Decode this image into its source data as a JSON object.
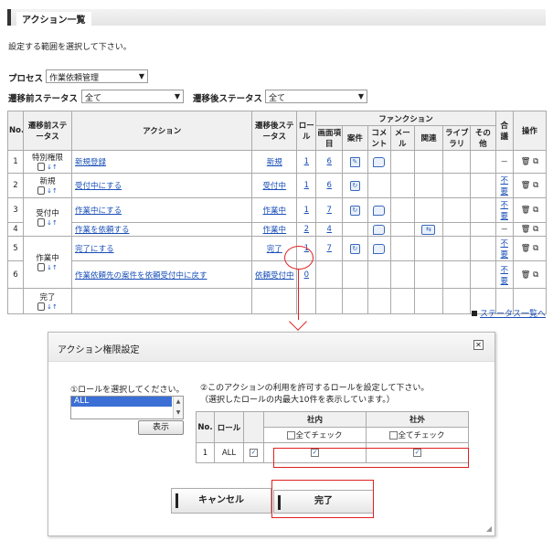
{
  "header": {
    "title": "アクション一覧",
    "intro": "設定する範囲を選択して下さい。"
  },
  "filters": {
    "process_label": "プロセス",
    "process_value": "作業依頼管理",
    "before_label": "遷移前ステータス",
    "before_value": "全て",
    "after_label": "遷移後ステータス",
    "after_value": "全て"
  },
  "table": {
    "h_no": "No.",
    "h_before": "遷移前ステータス",
    "h_action": "アクション",
    "h_after": "遷移後ステータス",
    "h_role": "ロール",
    "h_function": "ファンクション",
    "h_screen": "画面項目",
    "h_case": "案件",
    "h_comment": "コメント",
    "h_mail": "メール",
    "h_related": "関連",
    "h_library": "ライブラリ",
    "h_other": "その他",
    "h_meeting": "合議",
    "h_op": "操作",
    "rows": [
      {
        "no": "1",
        "before": "特別権限",
        "action": "新規登録",
        "after": "新規",
        "role": "1",
        "screen": "6",
        "meeting": "－"
      },
      {
        "no": "2",
        "before": "新規",
        "action": "受付中にする",
        "after": "受付中",
        "role": "1",
        "screen": "6",
        "meeting": "不要"
      },
      {
        "no": "3",
        "before": "受付中",
        "action": "作業中にする",
        "after": "作業中",
        "role": "1",
        "screen": "7",
        "meeting": "不要"
      },
      {
        "no": "4",
        "before": "",
        "action": "作業を依頼する",
        "after": "作業中",
        "role": "2",
        "screen": "4",
        "meeting": "－"
      },
      {
        "no": "5",
        "before": "作業中",
        "action": "完了にする",
        "after": "完了",
        "role": "1",
        "screen": "7",
        "meeting": "不要"
      },
      {
        "no": "6",
        "before": "",
        "action": "作業依頼先の案件を依頼受付中に戻す",
        "after": "依頼受付中",
        "role": "0",
        "screen": "",
        "meeting": "不要"
      },
      {
        "no": "",
        "before": "完了",
        "action": "",
        "after": "",
        "role": "",
        "screen": "",
        "meeting": ""
      }
    ]
  },
  "status_link": "ステータス一覧へ",
  "dialog": {
    "title": "アクション権限設定",
    "step1": "①ロールを選択してください。",
    "step2_line1": "②このアクションの利用を許可するロールを設定して下さい。",
    "step2_line2": "（選択したロールの内最大10件を表示しています。）",
    "list_item": "ALL",
    "show_button": "表示",
    "role_table": {
      "h_no": "No.",
      "h_role": "ロール",
      "h_inside": "社内",
      "h_outside": "社外",
      "check_all": "全てチェック",
      "row_no": "1",
      "row_role": "ALL"
    },
    "cancel_button": "キャンセル",
    "done_button": "完了"
  },
  "colors": {
    "link": "#1a4fb8",
    "highlight": "#e02020",
    "selected": "#3b6fd6"
  }
}
